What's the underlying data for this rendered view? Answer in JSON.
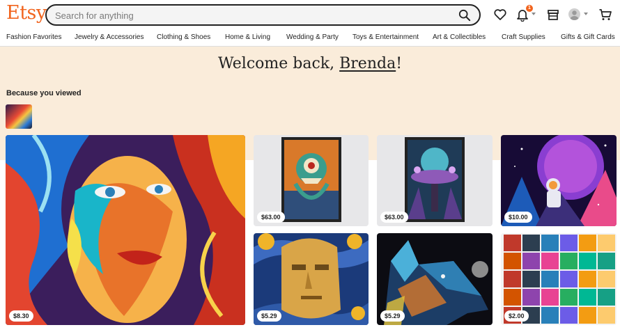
{
  "brand": {
    "logo": "Etsy",
    "accent": "#F1641E"
  },
  "search": {
    "placeholder": "Search for anything"
  },
  "header_icons": [
    "heart-icon",
    "bell-icon",
    "shop-icon",
    "avatar",
    "cart-icon"
  ],
  "notifications": {
    "count": "1"
  },
  "nav": [
    "Fashion Favorites",
    "Jewelry & Accessories",
    "Clothing & Shoes",
    "Home & Living",
    "Wedding & Party",
    "Toys & Entertainment",
    "Art & Collectibles",
    "Craft Supplies",
    "Gifts & Gift Cards"
  ],
  "hero": {
    "greeting": "Welcome back, ",
    "user": "Brenda",
    "punct": "!",
    "background": "#FAECDA"
  },
  "because_you_viewed": "Because you viewed",
  "listings": [
    {
      "price": "$8.30"
    },
    {
      "price": "$63.00"
    },
    {
      "price": "$63.00"
    },
    {
      "price": "$10.00"
    },
    {
      "price": "$5.29"
    },
    {
      "price": "$5.29"
    },
    {
      "price": "$2.00"
    }
  ]
}
